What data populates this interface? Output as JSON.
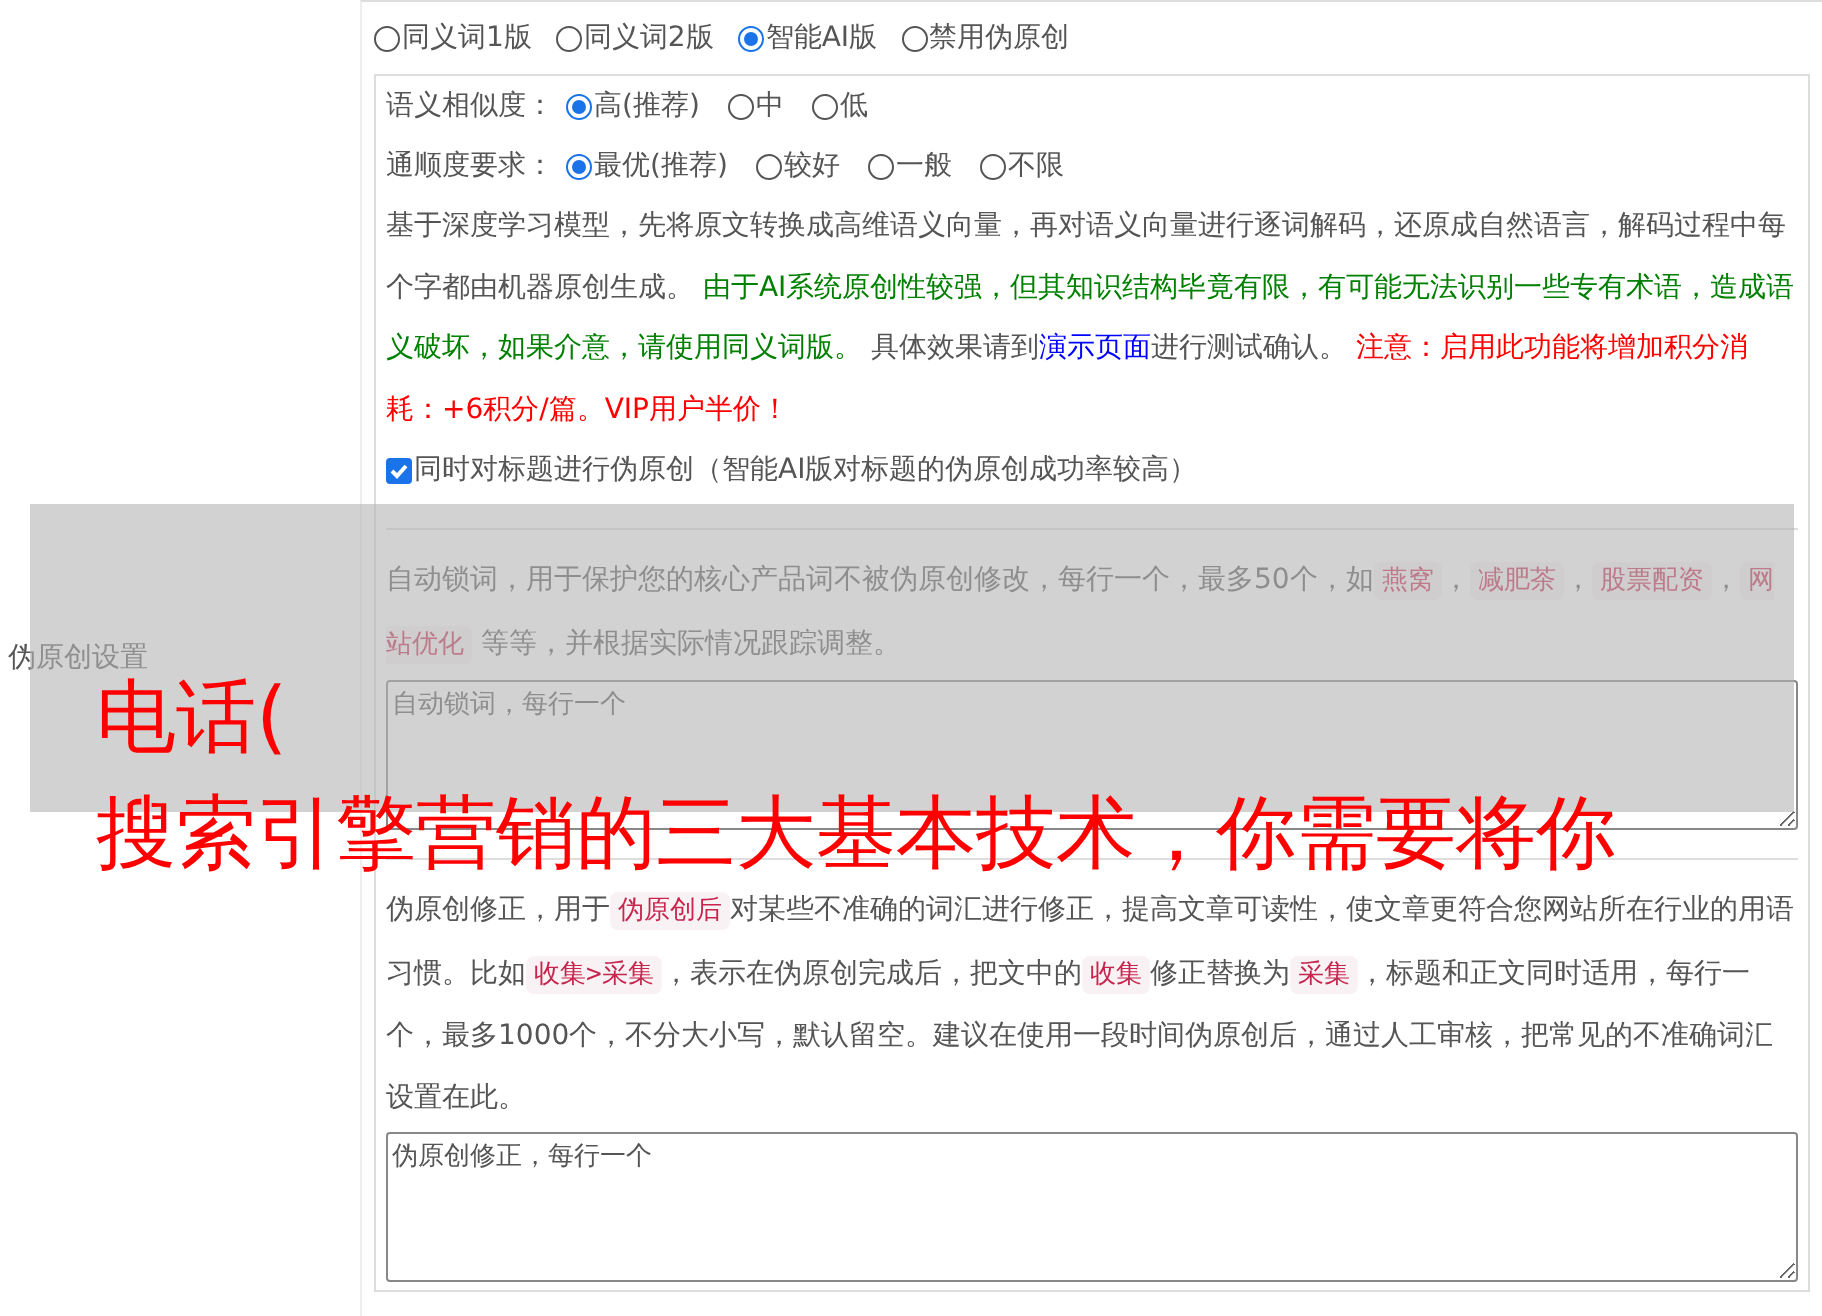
{
  "sidebar": {
    "label": "伪原创设置"
  },
  "mode_options": [
    {
      "label": "同义词1版",
      "selected": false
    },
    {
      "label": "同义词2版",
      "selected": false
    },
    {
      "label": "智能AI版",
      "selected": true
    },
    {
      "label": "禁用伪原创",
      "selected": false
    }
  ],
  "similarity": {
    "label": "语义相似度：",
    "options": [
      {
        "label": "高(推荐)",
        "selected": true
      },
      {
        "label": "中",
        "selected": false
      },
      {
        "label": "低",
        "selected": false
      }
    ]
  },
  "fluency": {
    "label": "通顺度要求：",
    "options": [
      {
        "label": "最优(推荐)",
        "selected": true
      },
      {
        "label": "较好",
        "selected": false
      },
      {
        "label": "一般",
        "selected": false
      },
      {
        "label": "不限",
        "selected": false
      }
    ]
  },
  "description": {
    "segments": [
      {
        "kind": "text",
        "text": "基于深度学习模型，先将原文转换成高维语义向量，再对语义向量进行逐词解码，还原成自然语言，解码过程中每个字都由机器原创生成。 "
      },
      {
        "kind": "notice",
        "text": "由于AI系统原创性较强，但其知识结构毕竟有限，有可能无法识别一些专有术语，造成语义破坏，如果介意，请使用同义词版。"
      },
      {
        "kind": "text",
        "text": " 具体效果请到"
      },
      {
        "kind": "link",
        "text": "演示页面"
      },
      {
        "kind": "text",
        "text": "进行测试确认。 "
      },
      {
        "kind": "warning",
        "text": "注意：启用此功能将增加积分消耗：+6积分/篇。VIP用户半价！"
      }
    ]
  },
  "title_checkbox": {
    "label": "同时对标题进行伪原创（智能AI版对标题的伪原创成功率较高）",
    "checked": true
  },
  "lock_words": {
    "segments": [
      {
        "kind": "text",
        "text": "自动锁词，用于保护您的核心产品词不被伪原创修改，每行一个，最多50个，如"
      },
      {
        "kind": "tag",
        "text": "燕窝"
      },
      {
        "kind": "text",
        "text": "，"
      },
      {
        "kind": "tag",
        "text": "减肥茶"
      },
      {
        "kind": "text",
        "text": "，"
      },
      {
        "kind": "tag",
        "text": "股票配资"
      },
      {
        "kind": "text",
        "text": "，"
      },
      {
        "kind": "tag",
        "text": "网站优化"
      },
      {
        "kind": "text",
        "text": " 等等，并根据实际情况跟踪调整。"
      }
    ],
    "placeholder": "自动锁词，每行一个"
  },
  "correction": {
    "segments": [
      {
        "kind": "text",
        "text": "伪原创修正，用于"
      },
      {
        "kind": "tag",
        "text": "伪原创后"
      },
      {
        "kind": "text",
        "text": "对某些不准确的词汇进行修正，提高文章可读性，使文章更符合您网站所在行业的用语习惯。比如"
      },
      {
        "kind": "tag",
        "text": "收集>采集"
      },
      {
        "kind": "text",
        "text": "，表示在伪原创完成后，把文中的"
      },
      {
        "kind": "tag",
        "text": "收集"
      },
      {
        "kind": "text",
        "text": "修正替换为"
      },
      {
        "kind": "tag",
        "text": "采集"
      },
      {
        "kind": "text",
        "text": "，标题和正文同时适用，每行一个，最多1000个，不分大小写，默认留空。建议在使用一段时间伪原创后，通过人工审核，把常见的不准确词汇设置在此。"
      }
    ],
    "placeholder": "伪原创修正，每行一个"
  },
  "overlay": {
    "lines": [
      "电话(",
      "搜索引擎营销的三大基本技术，你需要将你"
    ]
  }
}
